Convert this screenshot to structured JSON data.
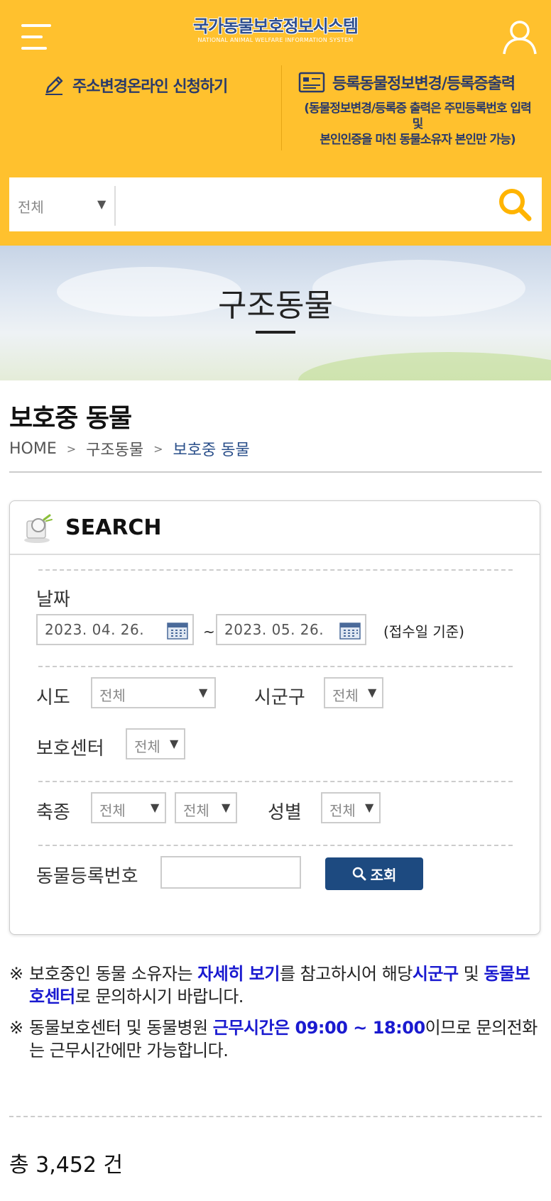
{
  "header": {
    "logo_text": "국가동물보호정보시스템",
    "logo_subtext": "NATIONAL ANIMAL WELFARE INFORMATION SYSTEM",
    "address_change_label": "주소변경온라인 신청하기",
    "reg_info_label": "등록동물정보변경/등록증출력",
    "reg_info_note_line1": "(동물정보변경/등록증 출력은 주민등록번호 입력 및",
    "reg_info_note_line2": "본인인증을 마친 동물소유자 본인만 가능)",
    "search": {
      "category_value": "전체",
      "placeholder": ""
    },
    "colors": {
      "background": "#FFC12E",
      "accent": "#2a3a6a"
    }
  },
  "banner": {
    "title": "구조동물"
  },
  "page": {
    "title": "보호중 동물",
    "breadcrumb": {
      "home": "HOME",
      "section": "구조동물",
      "current": "보호중 동물"
    }
  },
  "search_box": {
    "title": "SEARCH",
    "date_label": "날짜",
    "date_from": "2023. 04. 26.",
    "date_to": "2023. 05. 26.",
    "date_tilde": "~",
    "date_note": "(접수일 기준)",
    "sido_label": "시도",
    "sido_value": "전체",
    "sigungu_label": "시군구",
    "sigungu_value": "전체",
    "center_label": "보호센터",
    "center_value": "전체",
    "species_label": "축종",
    "species_value1": "전체",
    "species_value2": "전체",
    "gender_label": "성별",
    "gender_value": "전체",
    "reg_no_label": "동물등록번호",
    "reg_no_value": "",
    "query_button": "조회"
  },
  "notices": [
    {
      "mark": "※",
      "p1": "보호중인 동물 소유자는 ",
      "h1": "자세히 보기",
      "p2": "를 참고하시어 해당",
      "h2": "시군구",
      "p3": " 및 ",
      "h3": "동물보호센터",
      "p4": "로 문의하시기 바랍니다."
    },
    {
      "mark": "※",
      "p1": "동물보호센터 및 동물병원 ",
      "h1": "근무시간은 09:00 ~ 18:00",
      "p2": "이므로 문의전화는 근무시간에만 가능합니다."
    }
  ],
  "total_count_text": "총 3,452 건"
}
